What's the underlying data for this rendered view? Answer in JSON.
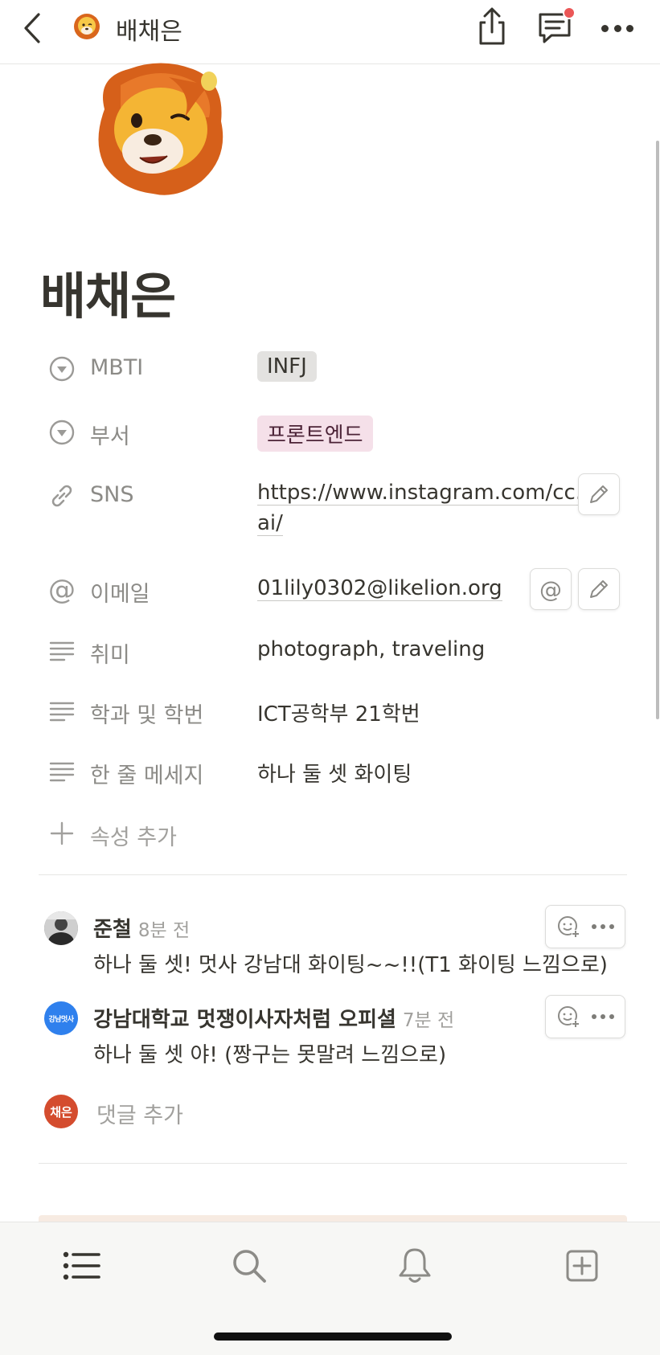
{
  "header": {
    "title": "배채은"
  },
  "page": {
    "title": "배채은"
  },
  "properties": [
    {
      "name": "MBTI",
      "value": "INFJ",
      "icon": "select-icon"
    },
    {
      "name": "부서",
      "value": "프론트엔드",
      "icon": "select-icon"
    },
    {
      "name": "SNS",
      "value_line1": "https://www.instagram.com/cc.",
      "value_line2": "ai/",
      "icon": "link-icon"
    },
    {
      "name": "이메일",
      "value": "01lily0302@likelion.org",
      "icon": "at-icon"
    },
    {
      "name": "취미",
      "value": "photograph, traveling",
      "icon": "text-icon"
    },
    {
      "name": "학과 및 학번",
      "value": "ICT공학부 21학번",
      "icon": "text-icon"
    },
    {
      "name": "한 줄 메세지",
      "value": "하나 둘 셋 화이팅",
      "icon": "text-icon"
    }
  ],
  "add_property_label": "속성 추가",
  "comments": [
    {
      "author": "준철",
      "time": "8분 전",
      "body": "하나 둘 셋! 멋사 강남대 화이팅~~!!(T1 화이팅 느낌으로)"
    },
    {
      "author": "강남대학교 멋쟁이사자처럼 오피셜",
      "time": "7분 전",
      "body": "하나 둘 셋 야! (짱구는 못말려 느낌으로)",
      "avatar_text": "강남멋사"
    }
  ],
  "comment_input": {
    "avatar_text": "채은",
    "placeholder": "댓글 추가"
  },
  "colors": {
    "tag_gray": "#e3e2e0",
    "tag_pink": "#f5e0e9",
    "notification_dot": "#eb5757",
    "user_avatar": "#d44c2e",
    "org_avatar": "#2f80ed"
  }
}
